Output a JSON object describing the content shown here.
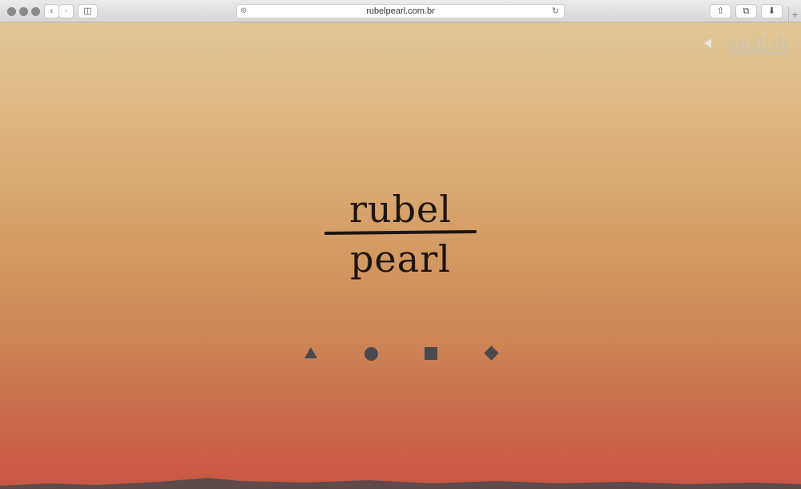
{
  "browser": {
    "url": "rubelpearl.com.br"
  },
  "page": {
    "language_link": "english",
    "logo_top": "rubel",
    "logo_bottom": "pearl",
    "nav_icons": [
      "triangle-icon",
      "circle-icon",
      "square-icon",
      "diamond-icon"
    ]
  }
}
